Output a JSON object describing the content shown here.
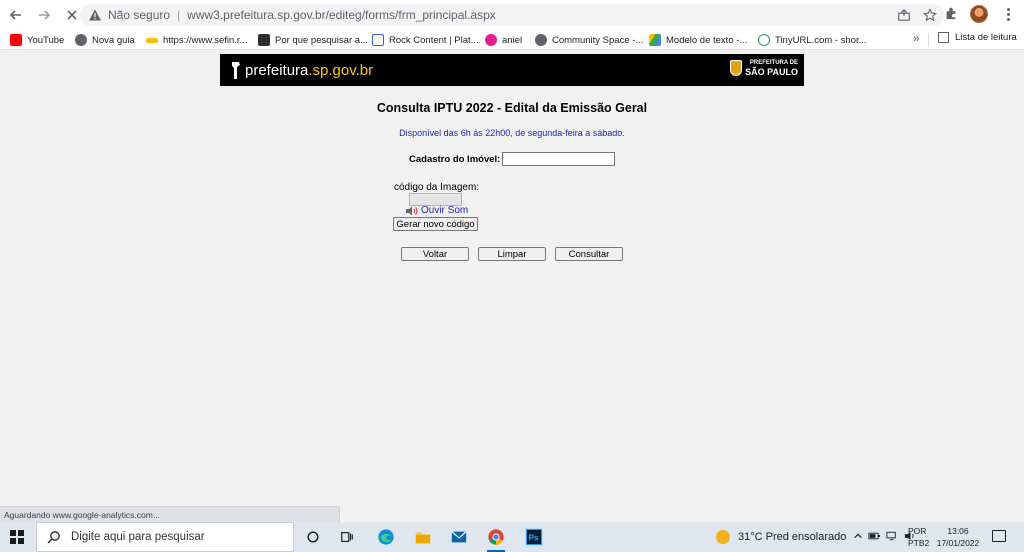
{
  "browser": {
    "insecure_label": "Não seguro",
    "url": "www3.prefeitura.sp.gov.br/editeg/forms/frm_principal.aspx",
    "bookmarks": [
      {
        "label": "YouTube",
        "color": "#ff0000"
      },
      {
        "label": "Nova guia",
        "color": "#5f6368"
      },
      {
        "label": "https://www.sefin.r...",
        "color": "#f4c20d"
      },
      {
        "label": "Por que pesquisar a...",
        "color": "#2f2f2f"
      },
      {
        "label": "Rock Content | Plat...",
        "color": "#3a5bd9"
      },
      {
        "label": "aniel",
        "color": "#e91e8c"
      },
      {
        "label": "Community Space -...",
        "color": "#5f6368"
      },
      {
        "label": "Modelo de texto -...",
        "color": "#34a853"
      },
      {
        "label": "TinyURL.com - shor...",
        "color": "#1aa260"
      }
    ],
    "reading_list": "Lista de leitura",
    "status_text": "Aguardando www.google-analytics.com..."
  },
  "page": {
    "banner_logo_prefix": "prefeitura",
    "banner_logo_suffix": ".sp.gov.br",
    "banner_city_top": "PREFEITURA DE",
    "banner_city_bottom": "SÃO PAULO",
    "title": "Consulta IPTU 2022 - Edital da Emissão Geral",
    "hours_note": "Disponível das 6h às 22h00, de segunda-feira a sábado.",
    "cadastro_label": "Cadastro do Imóvel:",
    "cadastro_value": "",
    "code_label": "código da Imagem:",
    "audio_link": "Ouvir Som",
    "new_code_button": "Gerar novo código",
    "back_button": "Voltar",
    "clear_button": "Limpar",
    "submit_button": "Consultar"
  },
  "taskbar": {
    "search_placeholder": "Digite aqui para pesquisar",
    "weather": "31°C  Pred ensolarado",
    "lang_top": "POR",
    "lang_bottom": "PTB2",
    "time": "13:06",
    "date": "17/01/2022"
  }
}
